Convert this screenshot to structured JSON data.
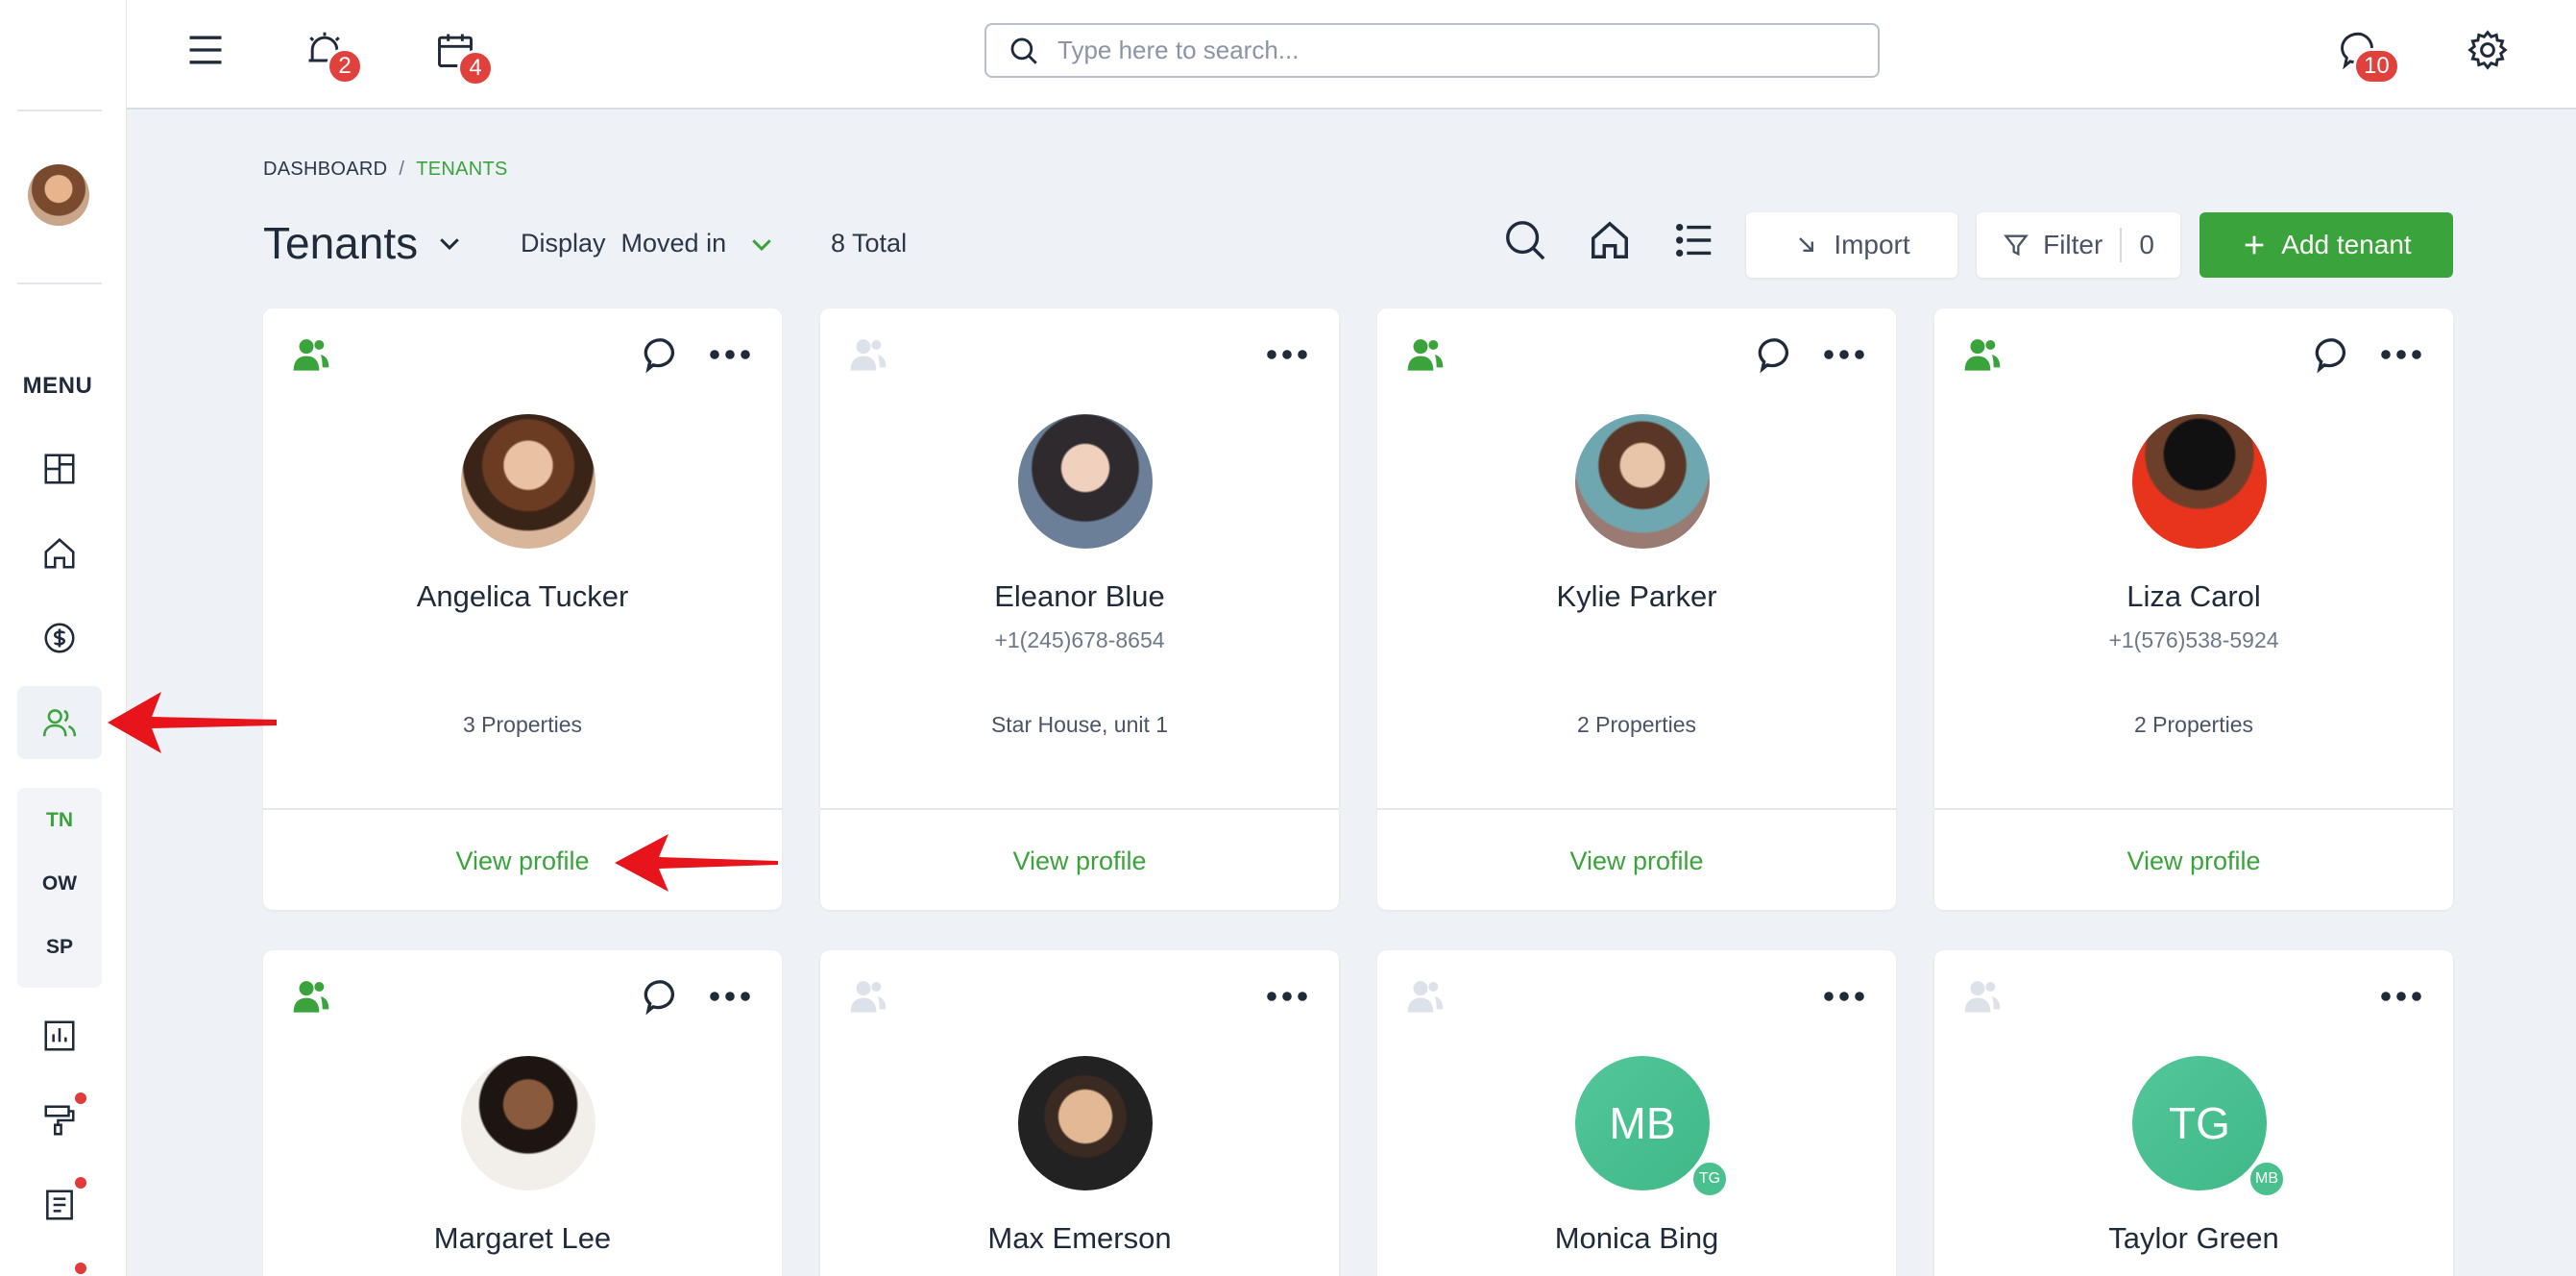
{
  "sidebar": {
    "menu_label": "MENU",
    "sub_items": [
      "TN",
      "OW",
      "SP"
    ]
  },
  "topbar": {
    "search_placeholder": "Type here to search...",
    "alerts_count": "2",
    "calendar_count": "4",
    "messages_count": "10"
  },
  "breadcrumb": {
    "root": "DASHBOARD",
    "separator": "/",
    "current": "TENANTS"
  },
  "header": {
    "title": "Tenants",
    "display_label": "Display",
    "display_value": "Moved in",
    "total": "8 Total",
    "import_label": "Import",
    "filter_label": "Filter",
    "filter_count": "0",
    "add_label": "Add tenant"
  },
  "colors": {
    "accent": "#3aa33b",
    "badge": "#e0413d",
    "initials_bg": "#49c08e"
  },
  "tenants": [
    {
      "name": "Angelica Tucker",
      "phone": "",
      "properties": "3 Properties",
      "view": "View profile",
      "active": true,
      "chat": true
    },
    {
      "name": "Eleanor Blue",
      "phone": "+1(245)678-8654",
      "properties": "Star House, unit 1",
      "view": "View profile",
      "active": false,
      "chat": false
    },
    {
      "name": "Kylie Parker",
      "phone": "",
      "properties": "2 Properties",
      "view": "View profile",
      "active": true,
      "chat": true
    },
    {
      "name": "Liza Carol",
      "phone": "+1(576)538-5924",
      "properties": "2 Properties",
      "view": "View profile",
      "active": true,
      "chat": true
    },
    {
      "name": "Margaret Lee",
      "active": true,
      "chat": true
    },
    {
      "name": "Max Emerson",
      "active": false,
      "chat": false
    },
    {
      "name": "Monica Bing",
      "initials": "MB",
      "mini_initials": "TG",
      "active": false,
      "chat": false
    },
    {
      "name": "Taylor Green",
      "initials": "TG",
      "mini_initials": "MB",
      "active": false,
      "chat": false
    }
  ]
}
